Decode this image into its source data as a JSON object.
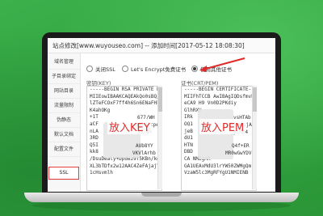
{
  "dialog": {
    "title": "站点修改[www.wuyouseo.com] -- 添加时间[2017-05-12 18:08:30]"
  },
  "sidebar": {
    "items": [
      {
        "label": "域名管理"
      },
      {
        "label": "子目录绑定"
      },
      {
        "label": "网站目录"
      },
      {
        "label": "流量限制"
      },
      {
        "label": "伪静态"
      },
      {
        "label": "默认文档"
      },
      {
        "label": "配置文件"
      },
      {
        "label": "SSL"
      }
    ],
    "active": "SSL"
  },
  "ssl_options": {
    "items": [
      {
        "label": "关闭SSL",
        "selected": false
      },
      {
        "label": "Let's Encrypt免费证书",
        "selected": false
      },
      {
        "label": "使用其他证书",
        "selected": true
      }
    ]
  },
  "key_panel": {
    "label": "密钥(KEY)",
    "overlay": "放入KEY",
    "lines": [
      "-----BEGIN RSA PRIVATE KEY-----",
      "MIIEowIBAAKCAQEAkQo0sBQ/N",
      "lZTeFCOxF7ff4h6Sn6ENaFHkgMR",
      "K4ahOKg",
      "+1T",
      "aCF",
      "nLA",
      "3RD",
      "Q5I",
      "kk8",
      "/DsuDealy+Dpdez9f5KBn/kdK4",
      "XL3bTDfx2w12AAC4ZeFAjajYt5I",
      "1cHsvmlh"
    ],
    "fragments": [
      "677/WH",
      "x+H0Ttpe",
      "x5/WX",
      "AUb8YY",
      "VKVlArhb"
    ]
  },
  "pem_panel": {
    "label": "证书(CRT/PEM)",
    "overlay": "放入PEM",
    "lines": [
      "-----BEGIN CERTIFICATE-----",
      "MIIFhTCCB   AwIBAgIQDsfmvh",
      "eCA9  H9    Vn0D2PKdiy",
      "GlhRXV",
      "IRk",
      "OQ1",
      "jeB",
      "dU1",
      "HTN",
      "DBD",
      "CA     NMBgAR",
      "GA1UEAxMdU3lrYW50ZWMgQm",
      "VzaW5lc3MgRFYgU1NMIENB"
    ],
    "fragments": [
      "vsHTAb",
      "Bkw4QsjA",
      "yzMA4",
      "Q4f+ER",
      "MR0wGwYDV"
    ]
  }
}
